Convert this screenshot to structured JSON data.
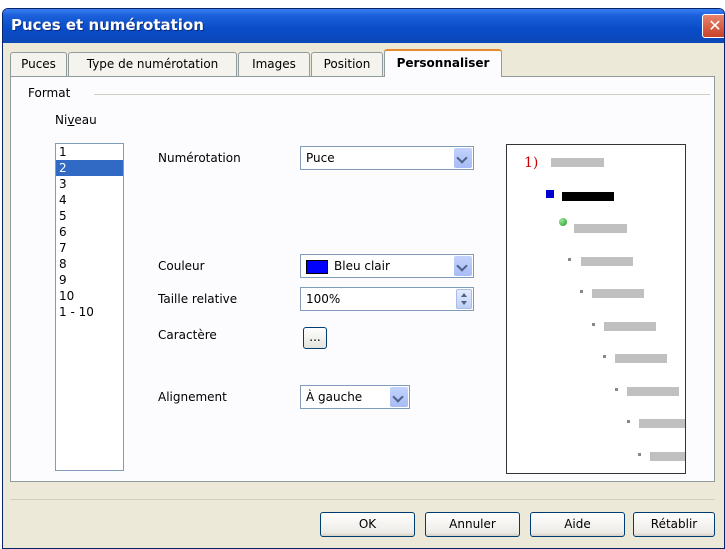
{
  "window": {
    "title": "Puces et numérotation",
    "close_symbol": "✕"
  },
  "tabs": [
    {
      "label": "Puces"
    },
    {
      "label": "Type de numérotation"
    },
    {
      "label": "Images"
    },
    {
      "label": "Position"
    },
    {
      "label": "Personnaliser",
      "active": true
    }
  ],
  "format": {
    "legend": "Format",
    "niveau_label": "Niveau",
    "levels": [
      "1",
      "2",
      "3",
      "4",
      "5",
      "6",
      "7",
      "8",
      "9",
      "10",
      "1 - 10"
    ],
    "selected_level": "2",
    "numerotation": {
      "label": "Numérotation",
      "value": "Puce"
    },
    "couleur": {
      "label": "Couleur",
      "value": "Bleu clair",
      "swatch": "#0000ff"
    },
    "taille": {
      "label": "Taille relative",
      "value": "100%"
    },
    "caractere": {
      "label": "Caractère",
      "button": "..."
    },
    "alignement": {
      "label": "Alignement",
      "value": "À gauche"
    }
  },
  "preview": {
    "number_label": "1)",
    "colors": {
      "number": "#cc0000",
      "bullet_square": "#0000cc",
      "bullet_ball": "#1e9a1e"
    }
  },
  "buttons": {
    "ok": "OK",
    "cancel": "Annuler",
    "help": "Aide",
    "reset": "Rétablir"
  }
}
